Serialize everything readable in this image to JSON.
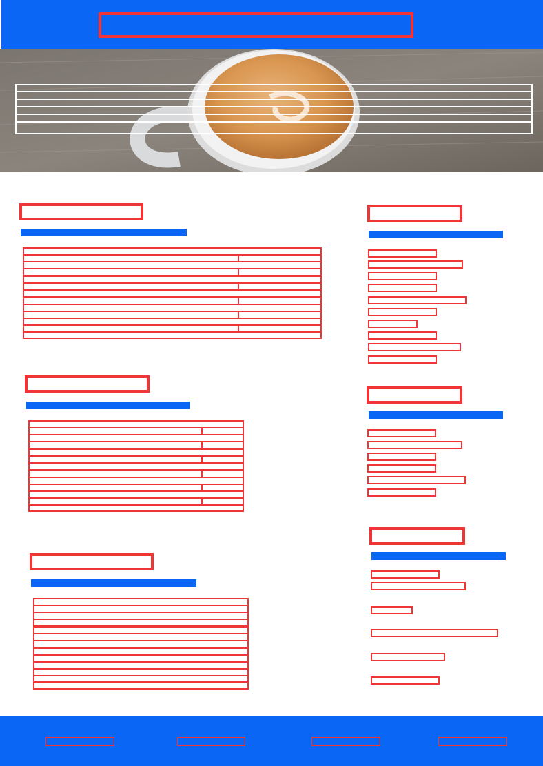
{
  "colors": {
    "brand": "#0a66f5",
    "annotation_red": "#ef3535",
    "annotation_white": "#ffffff"
  },
  "header": {
    "title": ""
  },
  "hero": {
    "image": "coffee-cup-latte-art",
    "overlay_lines": [
      "",
      "",
      "",
      "",
      "",
      ""
    ]
  },
  "sections": {
    "left_1": {
      "title": "",
      "subtitle": "",
      "rows": [
        [
          "",
          ""
        ],
        [
          "",
          ""
        ],
        [
          "",
          ""
        ],
        [
          "",
          ""
        ],
        [
          "",
          ""
        ],
        [
          "",
          ""
        ],
        [
          "",
          ""
        ],
        [
          "",
          ""
        ],
        [
          "",
          ""
        ],
        [
          "",
          ""
        ],
        [
          "",
          ""
        ],
        [
          ""
        ]
      ]
    },
    "left_2": {
      "title": "",
      "subtitle": "",
      "rows": [
        [
          ""
        ],
        [
          "",
          ""
        ],
        [
          "",
          ""
        ],
        [
          "",
          ""
        ],
        [
          "",
          ""
        ],
        [
          "",
          ""
        ],
        [
          "",
          ""
        ],
        [
          "",
          ""
        ],
        [
          "",
          ""
        ],
        [
          "",
          ""
        ],
        [
          "",
          ""
        ],
        [
          ""
        ]
      ]
    },
    "left_3": {
      "title": "",
      "subtitle": "",
      "rows": [
        "",
        "",
        "",
        "",
        "",
        "",
        "",
        "",
        "",
        "",
        "",
        "",
        ""
      ]
    },
    "right_1": {
      "title": "",
      "subtitle": "",
      "items": [
        "",
        "",
        "",
        "",
        "",
        "",
        "",
        "",
        "",
        ""
      ]
    },
    "right_2": {
      "title": "",
      "subtitle": "",
      "items": [
        "",
        "",
        "",
        "",
        "",
        ""
      ]
    },
    "right_3": {
      "title": "",
      "subtitle": "",
      "items": [
        "",
        "",
        "",
        "",
        "",
        ""
      ]
    }
  },
  "footer": {
    "links": [
      "",
      "",
      "",
      ""
    ]
  }
}
